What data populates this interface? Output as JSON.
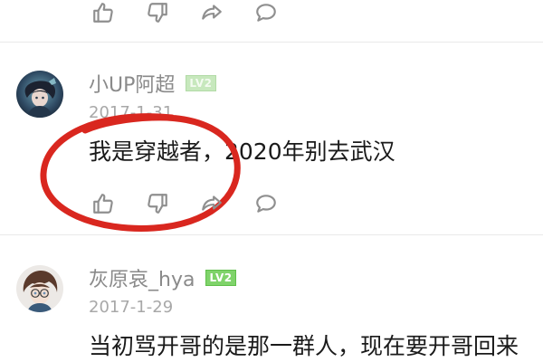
{
  "actions": [
    {
      "name": "thumbs-up-icon"
    },
    {
      "name": "thumbs-down-icon"
    },
    {
      "name": "share-icon"
    },
    {
      "name": "comment-icon"
    }
  ],
  "comments": [
    {
      "username": "小UP阿超",
      "level_badge": "LV2",
      "date": "2017-1-31",
      "text": "我是穿越者，2020年别去武汉"
    },
    {
      "username": "灰原哀_hya",
      "level_badge": "LV2",
      "date": "2017-1-29",
      "text": "当初骂开哥的是那一群人，现在要开哥回来"
    }
  ],
  "colors": {
    "annotation_circle": "#d9271f",
    "level_badge": "#7fd36a",
    "icon": "#8f8f8f"
  }
}
